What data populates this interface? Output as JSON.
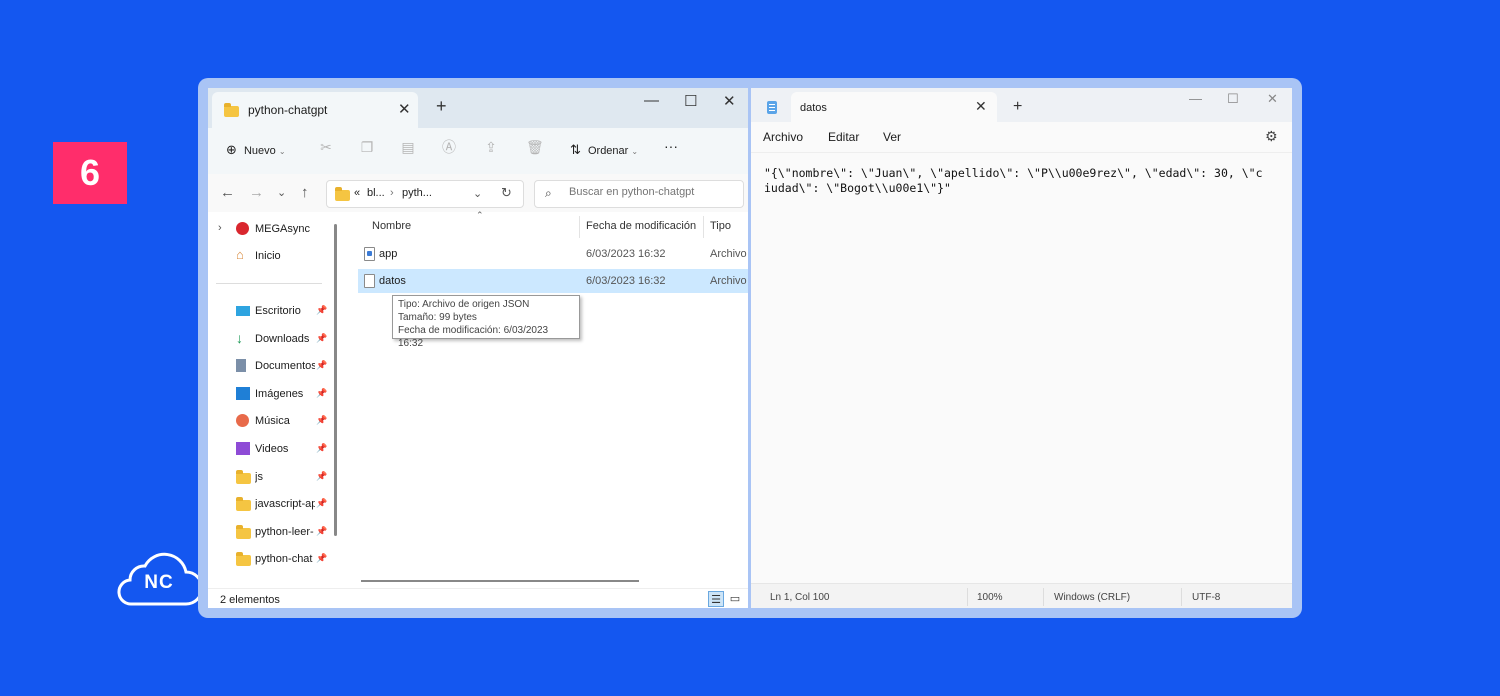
{
  "badge": {
    "number": "6"
  },
  "logo": {
    "text": "NC"
  },
  "explorer": {
    "tab_title": "python-chatgpt",
    "toolbar": {
      "new_label": "Nuevo",
      "sort_label": "Ordenar",
      "more": "···"
    },
    "address": {
      "crumb1": "bl...",
      "crumb2": "pyth...",
      "prefix": "«"
    },
    "search": {
      "placeholder": "Buscar en python-chatgpt"
    },
    "sidebar": {
      "items": [
        {
          "label": "MEGAsync",
          "icon": "megasync-icon"
        },
        {
          "label": "Inicio",
          "icon": "home-icon"
        },
        {
          "label": "Escritorio",
          "icon": "desktop-icon"
        },
        {
          "label": "Downloads",
          "icon": "download-icon"
        },
        {
          "label": "Documentos",
          "icon": "documents-icon"
        },
        {
          "label": "Imágenes",
          "icon": "pictures-icon"
        },
        {
          "label": "Música",
          "icon": "music-icon"
        },
        {
          "label": "Videos",
          "icon": "videos-icon"
        },
        {
          "label": "js",
          "icon": "folder-icon"
        },
        {
          "label": "javascript-ap",
          "icon": "folder-icon"
        },
        {
          "label": "python-leer-",
          "icon": "folder-icon"
        },
        {
          "label": "python-chat",
          "icon": "folder-icon"
        }
      ]
    },
    "columns": {
      "name": "Nombre",
      "date": "Fecha de modificación",
      "type": "Tipo"
    },
    "files": [
      {
        "name": "app",
        "date": "6/03/2023 16:32",
        "type": "Archivo"
      },
      {
        "name": "datos",
        "date": "6/03/2023 16:32",
        "type": "Archivo"
      }
    ],
    "tooltip": {
      "line1": "Tipo: Archivo de origen JSON",
      "line2": "Tamaño: 99 bytes",
      "line3": "Fecha de modificación: 6/03/2023 16:32"
    },
    "status": "2 elementos"
  },
  "notepad": {
    "tab_title": "datos",
    "menu": {
      "file": "Archivo",
      "edit": "Editar",
      "view": "Ver"
    },
    "content": "\"{\\\"nombre\\\": \\\"Juan\\\", \\\"apellido\\\": \\\"P\\\\u00e9rez\\\", \\\"edad\\\": 30, \\\"ciudad\\\": \\\"Bogot\\\\u00e1\\\"}\"",
    "status": {
      "position": "Ln 1, Col 100",
      "zoom": "100%",
      "line_ending": "Windows (CRLF)",
      "encoding": "UTF-8"
    }
  },
  "colors": {
    "background": "#1457f0",
    "badge": "#ff2d6b",
    "selection": "#cce8ff"
  }
}
